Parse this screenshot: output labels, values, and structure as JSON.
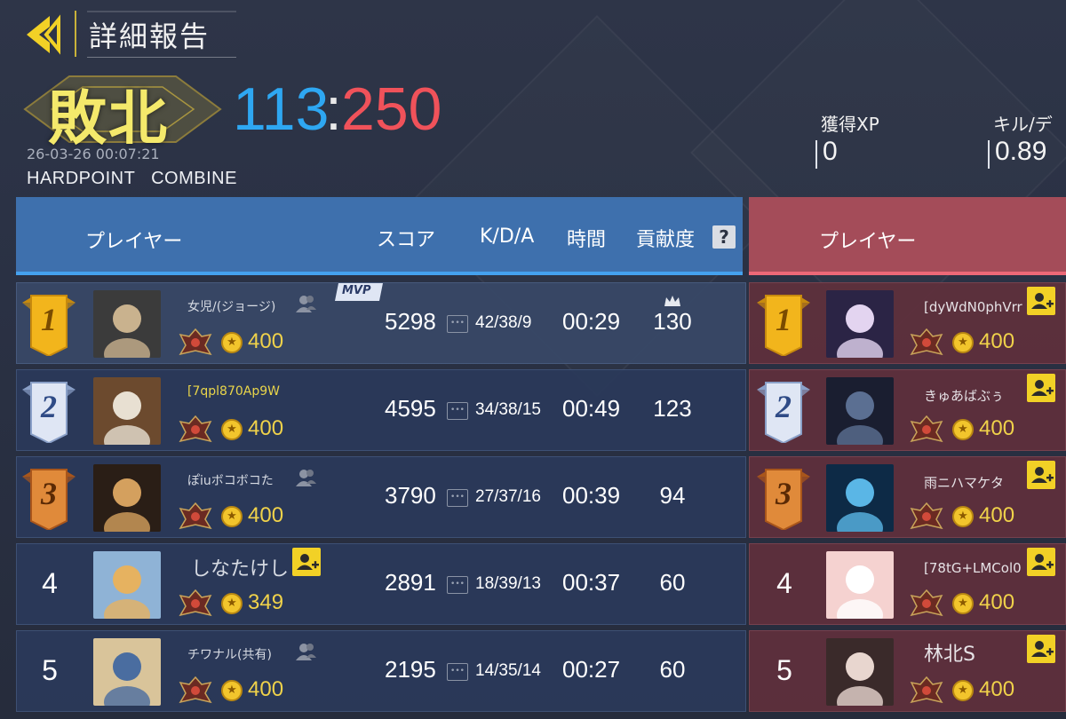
{
  "header": {
    "title": "詳細報告",
    "result": "敗北",
    "score_blue": "113",
    "score_colon": ":",
    "score_red": "250",
    "datetime": "26-03-26 00:07:21",
    "mode": "HARDPOINT   COMBINE",
    "stats": [
      {
        "label": "獲得XP",
        "value": "0"
      },
      {
        "label": "キル/デ",
        "value": "0.89"
      }
    ]
  },
  "columns": {
    "player": "プレイヤー",
    "score": "スコア",
    "kda": "K/D/A",
    "time": "時間",
    "contribution": "貢献度",
    "help": "?",
    "kda_icon": "•••",
    "enemy_player": "プレイヤー"
  },
  "mvp_label": "MVP",
  "coin_symbol": "★",
  "blue_team": [
    {
      "rank": "1",
      "name": "女児/(ジョージ)",
      "points": "400",
      "score": "5298",
      "kda": "42/38/9",
      "time": "00:29",
      "contribution": "130"
    },
    {
      "rank": "2",
      "name": "[7qpl870Ap9W",
      "points": "400",
      "score": "4595",
      "kda": "34/38/15",
      "time": "00:49",
      "contribution": "123"
    },
    {
      "rank": "3",
      "name": "ぽiuボコボコた",
      "points": "400",
      "score": "3790",
      "kda": "27/37/16",
      "time": "00:39",
      "contribution": "94"
    },
    {
      "rank": "4",
      "name": "しなたけし",
      "points": "349",
      "score": "2891",
      "kda": "18/39/13",
      "time": "00:37",
      "contribution": "60"
    },
    {
      "rank": "5",
      "name": "チワナル(共有)",
      "points": "400",
      "score": "2195",
      "kda": "14/35/14",
      "time": "00:27",
      "contribution": "60"
    }
  ],
  "red_team": [
    {
      "rank": "1",
      "name": "[dyWdN0phVrr",
      "points": "400"
    },
    {
      "rank": "2",
      "name": "きゅあばぶぅ",
      "points": "400"
    },
    {
      "rank": "3",
      "name": "雨ニハマケタ",
      "points": "400"
    },
    {
      "rank": "4",
      "name": "[78tG+LMCol0",
      "points": "400"
    },
    {
      "rank": "5",
      "name": "林北S",
      "points": "400"
    }
  ],
  "colors": {
    "blue_score": "#2ea7f2",
    "red_score": "#f0525a",
    "defeat": "#f4e96b",
    "blue_header": "#3e70ad",
    "red_header": "#a44c59",
    "gold": "#f0d24a"
  },
  "icons": {
    "back": "back-arrow-icon",
    "help": "help-icon",
    "add_friend": "add-friend-icon",
    "friend": "friend-icon",
    "crown": "crown-icon",
    "rank_emblem": "rank-emblem-icon",
    "coin": "coin-icon",
    "kda_detail": "kda-detail-icon"
  }
}
